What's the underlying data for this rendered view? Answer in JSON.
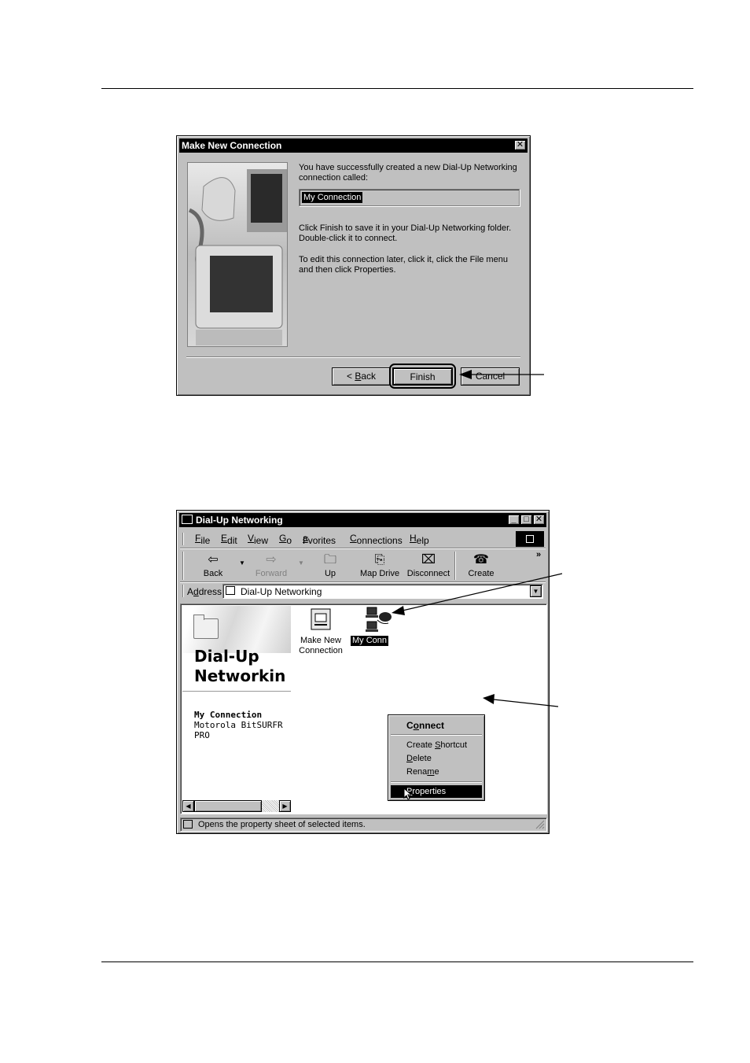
{
  "dialog1": {
    "title": "Make New Connection",
    "close_glyph": "✕",
    "message_success": "You have successfully created a new Dial-Up Networking connection called:",
    "connection_name": "My Connection",
    "message_finish": "Click Finish to save it in your Dial-Up Networking folder. Double-click it to connect.",
    "message_edit": "To edit this connection later, click it, click the File menu and then click Properties.",
    "back_prefix": "< ",
    "back_key": "B",
    "back_rest": "ack",
    "finish_label": "Finish",
    "cancel_label": "Cancel"
  },
  "window2": {
    "title": "Dial-Up Networking",
    "menu": [
      {
        "key": "F",
        "rest": "ile"
      },
      {
        "key": "E",
        "rest": "dit"
      },
      {
        "key": "V",
        "rest": "iew"
      },
      {
        "key": "G",
        "rest": "o"
      },
      {
        "pre": "F",
        "key": "a",
        "rest": "vorites"
      },
      {
        "key": "C",
        "rest": "onnections"
      },
      {
        "key": "H",
        "rest": "elp"
      }
    ],
    "toolbar": {
      "back": "Back",
      "forward": "Forward",
      "up": "Up",
      "map_drive": "Map Drive",
      "disconnect": "Disconnect",
      "create": "Create",
      "more": "»"
    },
    "address_label_pre": "A",
    "address_label_key": "d",
    "address_label_rest": "dress",
    "address_value": "Dial-Up Networking",
    "left_pane": {
      "heading": "Dial-Up\nNetworkin",
      "conn_name": "My Connection",
      "device_line1": "Motorola BitSURFR",
      "device_line2": "PRO"
    },
    "icons": {
      "make_new_line1": "Make New",
      "make_new_line2": "Connection",
      "my_conn": "My Conn"
    },
    "context_menu": {
      "connect_pre": "C",
      "connect_key": "o",
      "connect_rest": "nnect",
      "shortcut_pre": "Create ",
      "shortcut_key": "S",
      "shortcut_rest": "hortcut",
      "delete_key": "D",
      "delete_rest": "elete",
      "rename_pre": "Rena",
      "rename_key": "m",
      "rename_rest": "e",
      "properties_key": "P",
      "properties_rest": "roperties"
    },
    "status_text": "Opens the property sheet of selected items."
  }
}
